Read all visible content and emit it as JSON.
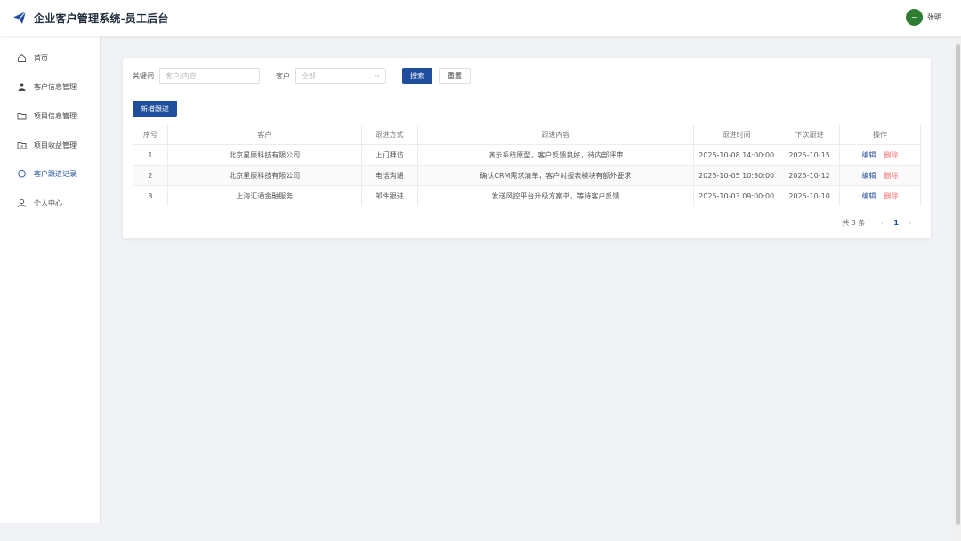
{
  "header": {
    "title": "企业客户管理系统-员工后台",
    "avatar_initial": "~",
    "username": "张明"
  },
  "sidebar": {
    "items": [
      {
        "label": "首页",
        "icon": "home-icon"
      },
      {
        "label": "客户信息管理",
        "icon": "user-icon"
      },
      {
        "label": "项目信息管理",
        "icon": "folder-icon"
      },
      {
        "label": "项目收益管理",
        "icon": "folder-chart-icon"
      },
      {
        "label": "客户跟进记录",
        "icon": "chat-icon",
        "active": true
      },
      {
        "label": "个人中心",
        "icon": "person-icon"
      }
    ]
  },
  "filters": {
    "keyword_label": "关键词",
    "keyword_placeholder": "客户/内容",
    "keyword_value": "",
    "customer_label": "客户",
    "customer_value": "全部",
    "search_label": "搜索",
    "reset_label": "重置"
  },
  "add_button_label": "新增跟进",
  "table": {
    "columns": [
      "序号",
      "客户",
      "跟进方式",
      "跟进内容",
      "跟进时间",
      "下次跟进",
      "操作"
    ],
    "rows": [
      {
        "index": "1",
        "customer": "北京星辰科技有限公司",
        "method": "上门拜访",
        "content": "演示系统原型，客户反馈良好，待内部评审",
        "time": "2025-10-08 14:00:00",
        "next": "2025-10-15"
      },
      {
        "index": "2",
        "customer": "北京星辰科技有限公司",
        "method": "电话沟通",
        "content": "确认CRM需求清单，客户对报表模块有额外要求",
        "time": "2025-10-05 10:30:00",
        "next": "2025-10-12"
      },
      {
        "index": "3",
        "customer": "上海汇通金融服务",
        "method": "邮件跟进",
        "content": "发送风控平台升级方案书，等待客户反馈",
        "time": "2025-10-03 09:00:00",
        "next": "2025-10-10"
      }
    ],
    "edit_label": "编辑",
    "delete_label": "删除"
  },
  "pagination": {
    "total": "共 3 条",
    "prev": "‹",
    "current": "1",
    "next": "›"
  },
  "colors": {
    "primary": "#1f4e9c",
    "danger": "#f56c6c",
    "avatar": "#2e7d32"
  }
}
